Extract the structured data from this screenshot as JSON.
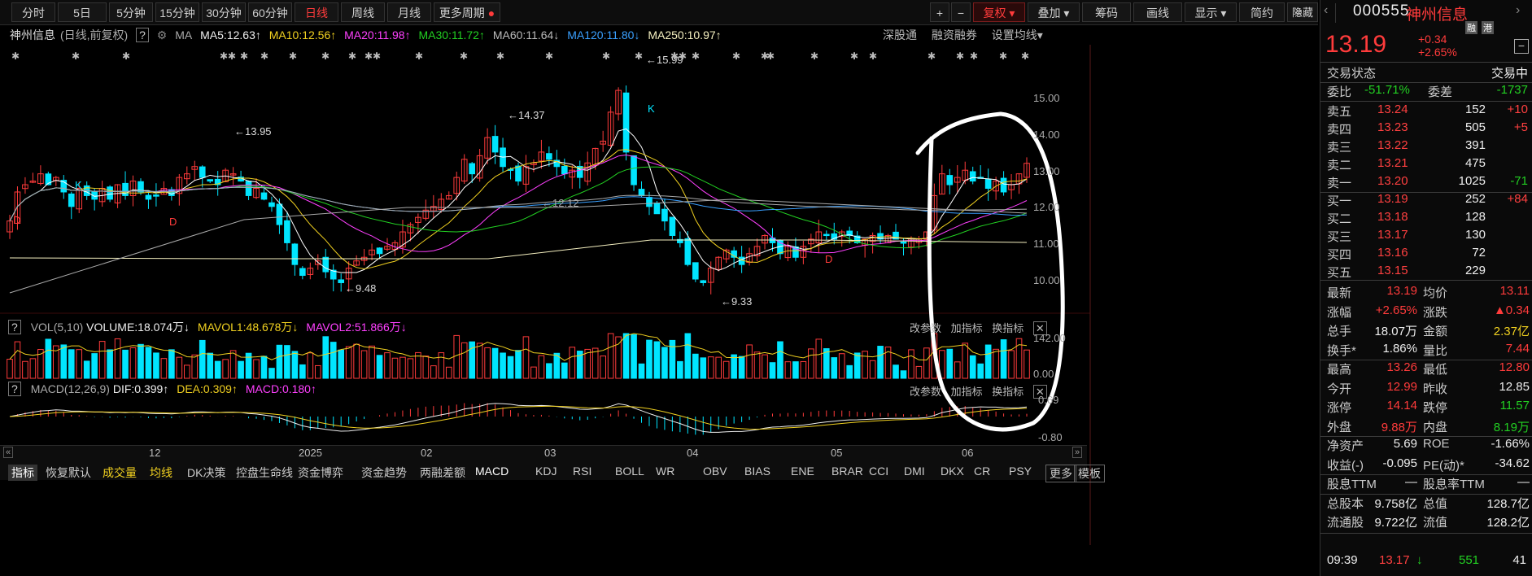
{
  "toolbar": {
    "periods": [
      "分时",
      "5日",
      "5分钟",
      "15分钟",
      "30分钟",
      "60分钟",
      "日线",
      "周线",
      "月线",
      "更多周期"
    ],
    "active_period": "日线",
    "right_buttons": [
      "+",
      "−",
      "复权",
      "叠加",
      "筹码",
      "画线",
      "显示",
      "简约",
      "隐藏"
    ],
    "window_icons": [
      "«",
      "⛶"
    ]
  },
  "ma_line": {
    "name": "神州信息",
    "mode": "(日线,前复权)",
    "ma_label": "MA",
    "ma5": "MA5:12.63",
    "ma10": "MA10:12.56",
    "ma20": "MA20:11.98",
    "ma30": "MA30:11.72",
    "ma60": "MA60:11.64",
    "ma120": "MA120:11.80",
    "ma250": "MA250:10.97",
    "tools": [
      "深股通",
      "融资融券",
      "设置均线"
    ]
  },
  "colors": {
    "up": "#ff3b3b",
    "down": "#00e5ff",
    "ma5": "#ffffff",
    "ma10": "#f0d020",
    "ma20": "#ff40ff",
    "ma30": "#22d022",
    "ma60": "#aaaaaa",
    "ma120": "#3aa0ff",
    "ma250": "#f5f0c0"
  },
  "chart_data": {
    "type": "candlestick",
    "y_axis_ticks": [
      "15.00",
      "14.00",
      "13.00",
      "12.00",
      "11.00",
      "10.00"
    ],
    "x_axis_ticks": [
      "12",
      "2025",
      "02",
      "03",
      "04",
      "05",
      "06"
    ],
    "annotations": [
      "15.99",
      "14.37",
      "13.95",
      "12.12",
      "9.48",
      "9.33"
    ],
    "markers": [
      "D",
      "K",
      "D",
      "K",
      "D"
    ],
    "closes": [
      11.6,
      12.4,
      12.6,
      12.7,
      12.9,
      12.6,
      12.8,
      12.4,
      12.0,
      12.5,
      12.3,
      12.2,
      12.5,
      12.2,
      12.6,
      12.3,
      12.7,
      12.4,
      12.2,
      12.3,
      12.5,
      12.3,
      12.8,
      12.9,
      13.1,
      12.8,
      12.7,
      12.6,
      13.0,
      12.9,
      12.7,
      12.3,
      12.5,
      12.2,
      12.0,
      11.5,
      11.0,
      10.4,
      10.1,
      10.3,
      10.5,
      10.2,
      10.0,
      9.9,
      10.3,
      10.5,
      10.6,
      10.8,
      10.7,
      10.9,
      11.0,
      11.3,
      11.5,
      11.7,
      11.9,
      12.0,
      12.2,
      12.3,
      12.8,
      13.3,
      12.9,
      13.4,
      13.9,
      13.5,
      13.1,
      13.0,
      12.7,
      13.1,
      13.2,
      13.5,
      13.3,
      13.1,
      12.9,
      13.0,
      12.8,
      13.2,
      13.6,
      13.8,
      14.6,
      15.2,
      13.5,
      12.6,
      12.3,
      12.0,
      11.8,
      11.6,
      11.2,
      11.0,
      10.4,
      10.0,
      9.9,
      10.3,
      10.6,
      10.8,
      10.6,
      10.4,
      10.7,
      10.9,
      11.2,
      11.0,
      10.7,
      10.9,
      10.6,
      10.9,
      11.1,
      11.3,
      11.2,
      11.1,
      11.3,
      11.2,
      11.0,
      11.1,
      11.2,
      11.1,
      11.2,
      11.1,
      11.0,
      11.1,
      11.1,
      11.3,
      12.3,
      12.9,
      12.6,
      12.8,
      13.0,
      12.7,
      12.8,
      12.5,
      12.7,
      12.4,
      12.6,
      12.9,
      13.19
    ],
    "volume": {
      "title": "VOL(5,10)",
      "volume_label": "VOLUME:18.074万",
      "mavol1": "MAVOL1:48.678万",
      "mavol2": "MAVOL2:51.866万",
      "y_ticks": [
        "142.00",
        "0.00"
      ]
    },
    "macd": {
      "title": "MACD(12,26,9)",
      "dif": "DIF:0.399",
      "dea": "DEA:0.309",
      "macd": "MACD:0.180",
      "y_ticks": [
        "0.69",
        "-0.80"
      ]
    }
  },
  "sub_tools": [
    "改参数",
    "加指标",
    "换指标"
  ],
  "bottom_tabs": [
    "指标",
    "恢复默认",
    "成交量",
    "均线",
    "DK决策",
    "控盘生命线",
    "资金博弈",
    "资金趋势",
    "两融差额",
    "MACD",
    "KDJ",
    "RSI",
    "BOLL",
    "WR",
    "OBV",
    "BIAS",
    "ENE",
    "BRAR",
    "CCI",
    "DMI",
    "DKX",
    "CR",
    "PSY",
    "更多",
    "模板"
  ],
  "quote": {
    "code": "000555",
    "name": "神州信息",
    "badges": [
      "融",
      "港"
    ],
    "price": "13.19",
    "change": "+0.34",
    "change_pct": "+2.65%",
    "status_label": "交易状态",
    "status_value": "交易中",
    "weibi_label": "委比",
    "weibi": "-51.71%",
    "weicha_label": "委差",
    "weicha": "-1737",
    "asks": [
      {
        "label": "卖五",
        "price": "13.24",
        "vol": "152",
        "chg": "+10"
      },
      {
        "label": "卖四",
        "price": "13.23",
        "vol": "505",
        "chg": "+5"
      },
      {
        "label": "卖三",
        "price": "13.22",
        "vol": "391",
        "chg": ""
      },
      {
        "label": "卖二",
        "price": "13.21",
        "vol": "475",
        "chg": ""
      },
      {
        "label": "卖一",
        "price": "13.20",
        "vol": "1025",
        "chg": "-71"
      }
    ],
    "bids": [
      {
        "label": "买一",
        "price": "13.19",
        "vol": "252",
        "chg": "+84"
      },
      {
        "label": "买二",
        "price": "13.18",
        "vol": "128",
        "chg": ""
      },
      {
        "label": "买三",
        "price": "13.17",
        "vol": "130",
        "chg": ""
      },
      {
        "label": "买四",
        "price": "13.16",
        "vol": "72",
        "chg": ""
      },
      {
        "label": "买五",
        "price": "13.15",
        "vol": "229",
        "chg": ""
      }
    ],
    "stats": [
      {
        "k1": "最新",
        "v1": "13.19",
        "k2": "均价",
        "v2": "13.11"
      },
      {
        "k1": "涨幅",
        "v1": "+2.65%",
        "k2": "涨跌",
        "v2": "▲0.34"
      },
      {
        "k1": "总手",
        "v1": "18.07万",
        "k2": "金额",
        "v2": "2.37亿"
      },
      {
        "k1": "换手*",
        "v1": "1.86%",
        "k2": "量比",
        "v2": "7.44"
      },
      {
        "k1": "最高",
        "v1": "13.26",
        "k2": "最低",
        "v2": "12.80"
      },
      {
        "k1": "今开",
        "v1": "12.99",
        "k2": "昨收",
        "v2": "12.85"
      },
      {
        "k1": "涨停",
        "v1": "14.14",
        "k2": "跌停",
        "v2": "11.57"
      },
      {
        "k1": "外盘",
        "v1": "9.88万",
        "k2": "内盘",
        "v2": "8.19万"
      },
      {
        "k1": "净资产",
        "v1": "5.69",
        "k2": "ROE",
        "v2": "-1.66%"
      },
      {
        "k1": "收益(-)",
        "v1": "-0.095",
        "k2": "PE(动)*",
        "v2": "-34.62"
      },
      {
        "k1": "股息TTM",
        "v1": "—",
        "k2": "股息率TTM",
        "v2": "—"
      },
      {
        "k1": "总股本",
        "v1": "9.758亿",
        "k2": "总值",
        "v2": "128.7亿"
      },
      {
        "k1": "流通股",
        "v1": "9.722亿",
        "k2": "流值",
        "v2": "128.2亿"
      }
    ],
    "tick": {
      "time": "09:39",
      "price": "13.17",
      "vol": "551",
      "n": "41"
    }
  }
}
